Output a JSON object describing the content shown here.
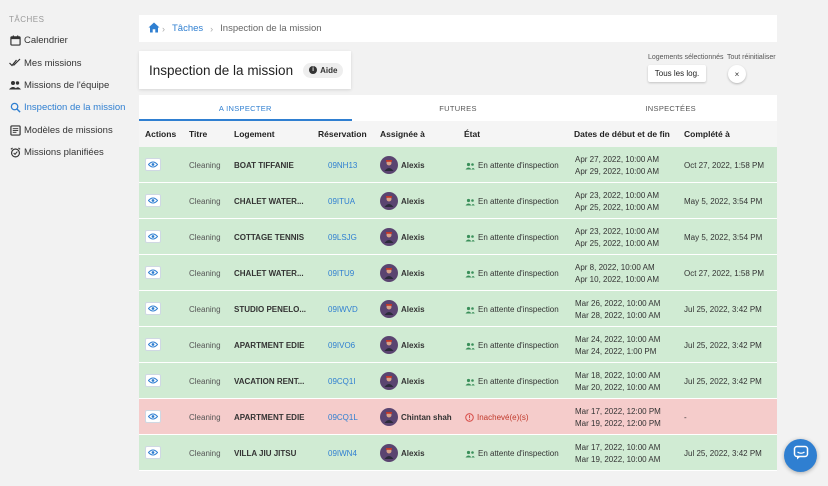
{
  "sidebar": {
    "header": "TÂCHES",
    "items": [
      {
        "label": "Calendrier",
        "icon": "calendar-icon"
      },
      {
        "label": "Mes missions",
        "icon": "checkmark-icon"
      },
      {
        "label": "Missions de l'équipe",
        "icon": "team-icon"
      },
      {
        "label": "Inspection de la mission",
        "icon": "search-icon"
      },
      {
        "label": "Modèles de missions",
        "icon": "template-icon"
      },
      {
        "label": "Missions planifiées",
        "icon": "alarm-icon"
      }
    ]
  },
  "breadcrumb": {
    "link": "Tâches",
    "current": "Inspection de la mission"
  },
  "header": {
    "title": "Inspection de la mission",
    "help_label": "Aide",
    "selected_label": "Logements sélectionnés",
    "reset_label": "Tout réinitialiser",
    "all_button": "Tous les log.",
    "close_label": "×"
  },
  "tabs": [
    "A INSPECTER",
    "FUTURES",
    "INSPECTÉES"
  ],
  "columns": [
    "Actions",
    "Titre",
    "Logement",
    "Réservation",
    "Assignée à",
    "État",
    "Dates de début et de fin",
    "Complété à"
  ],
  "rows": [
    {
      "titre": "Cleaning",
      "logement": "BOAT TIFFANIE",
      "reservation": "09NH13",
      "assignee": "Alexis",
      "etat": "En attente d'inspection",
      "start": "Apr 27, 2022, 10:00 AM",
      "end": "Apr 29, 2022, 10:00 AM",
      "complete": "Oct 27, 2022, 1:58 PM",
      "status": "green"
    },
    {
      "titre": "Cleaning",
      "logement": "CHALET WATER...",
      "reservation": "09ITUA",
      "assignee": "Alexis",
      "etat": "En attente d'inspection",
      "start": "Apr 23, 2022, 10:00 AM",
      "end": "Apr 25, 2022, 10:00 AM",
      "complete": "May 5, 2022, 3:54 PM",
      "status": "green"
    },
    {
      "titre": "Cleaning",
      "logement": "COTTAGE TENNIS",
      "reservation": "09LSJG",
      "assignee": "Alexis",
      "etat": "En attente d'inspection",
      "start": "Apr 23, 2022, 10:00 AM",
      "end": "Apr 25, 2022, 10:00 AM",
      "complete": "May 5, 2022, 3:54 PM",
      "status": "green"
    },
    {
      "titre": "Cleaning",
      "logement": "CHALET WATER...",
      "reservation": "09ITU9",
      "assignee": "Alexis",
      "etat": "En attente d'inspection",
      "start": "Apr 8, 2022, 10:00 AM",
      "end": "Apr 10, 2022, 10:00 AM",
      "complete": "Oct 27, 2022, 1:58 PM",
      "status": "green"
    },
    {
      "titre": "Cleaning",
      "logement": "STUDIO PENELO...",
      "reservation": "09IWVD",
      "assignee": "Alexis",
      "etat": "En attente d'inspection",
      "start": "Mar 26, 2022, 10:00 AM",
      "end": "Mar 28, 2022, 10:00 AM",
      "complete": "Jul 25, 2022, 3:42 PM",
      "status": "green"
    },
    {
      "titre": "Cleaning",
      "logement": "APARTMENT EDIE",
      "reservation": "09IVO6",
      "assignee": "Alexis",
      "etat": "En attente d'inspection",
      "start": "Mar 24, 2022, 10:00 AM",
      "end": "Mar 24, 2022, 1:00 PM",
      "complete": "Jul 25, 2022, 3:42 PM",
      "status": "green"
    },
    {
      "titre": "Cleaning",
      "logement": "VACATION RENT...",
      "reservation": "09CQ1I",
      "assignee": "Alexis",
      "etat": "En attente d'inspection",
      "start": "Mar 18, 2022, 10:00 AM",
      "end": "Mar 20, 2022, 10:00 AM",
      "complete": "Jul 25, 2022, 3:42 PM",
      "status": "green"
    },
    {
      "titre": "Cleaning",
      "logement": "APARTMENT EDIE",
      "reservation": "09CQ1L",
      "assignee": "Chintan shah",
      "etat": "Inachevé(e)(s)",
      "start": "Mar 17, 2022, 12:00 PM",
      "end": "Mar 19, 2022, 12:00 PM",
      "complete": "-",
      "status": "red"
    },
    {
      "titre": "Cleaning",
      "logement": "VILLA JIU JITSU",
      "reservation": "09IWN4",
      "assignee": "Alexis",
      "etat": "En attente d'inspection",
      "start": "Mar 17, 2022, 10:00 AM",
      "end": "Mar 19, 2022, 10:00 AM",
      "complete": "Jul 25, 2022, 3:42 PM",
      "status": "green"
    }
  ],
  "colors": {
    "accent": "#2f7fd1",
    "row_green": "#d0ebd3",
    "row_red": "#f5cccb",
    "error": "#d9534f"
  }
}
